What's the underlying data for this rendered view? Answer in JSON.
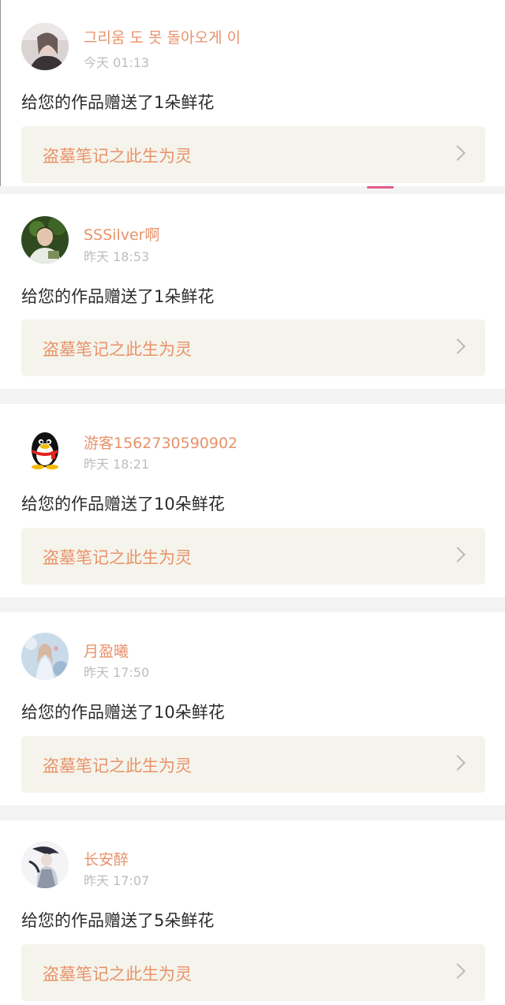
{
  "notifications": [
    {
      "username": "그리움 도 못 돌아오게 이",
      "time": "今天 01:13",
      "message": "给您的作品赠送了1朵鲜花",
      "work_title": "盗墓笔记之此生为灵",
      "avatar_icon": "girl-photo-avatar"
    },
    {
      "username": "SSSilver啊",
      "time": "昨天 18:53",
      "message": "给您的作品赠送了1朵鲜花",
      "work_title": "盗墓笔记之此生为灵",
      "avatar_icon": "boy-photo-avatar"
    },
    {
      "username": "游客1562730590902",
      "time": "昨天 18:21",
      "message": "给您的作品赠送了10朵鲜花",
      "work_title": "盗墓笔记之此生为灵",
      "avatar_icon": "qq-penguin-avatar"
    },
    {
      "username": "月盈曦",
      "time": "昨天 17:50",
      "message": "给您的作品赠送了10朵鲜花",
      "work_title": "盗墓笔记之此生为灵",
      "avatar_icon": "anime-girl-avatar"
    },
    {
      "username": "长安醉",
      "time": "昨天 17:07",
      "message": "给您的作品赠送了5朵鲜花",
      "work_title": "盗墓笔记之此生为灵",
      "avatar_icon": "ink-figure-avatar"
    }
  ],
  "colors": {
    "username": "#e8926a",
    "time": "#bdbdbd",
    "message": "#2b2b2b",
    "work_link_bg": "#f5f4ec",
    "accent": "#e25b8c",
    "separator": "#f3f3f3"
  }
}
